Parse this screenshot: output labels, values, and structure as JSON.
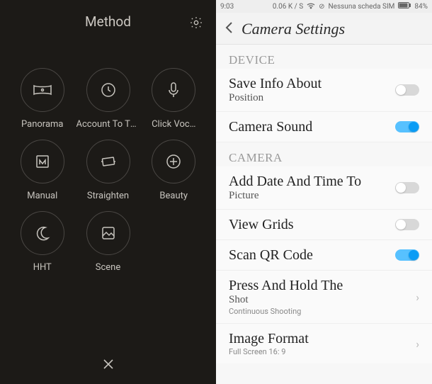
{
  "left": {
    "title": "Method",
    "tiles": [
      {
        "label": "Panorama",
        "icon": "panorama"
      },
      {
        "label": "Account To The…",
        "icon": "timer"
      },
      {
        "label": "Click Voc…",
        "icon": "mic"
      },
      {
        "label": "Manual",
        "icon": "manual"
      },
      {
        "label": "Straighten",
        "icon": "straighten"
      },
      {
        "label": "Beauty",
        "icon": "beauty"
      },
      {
        "label": "HHT",
        "icon": "moon"
      },
      {
        "label": "Scene",
        "icon": "scene"
      }
    ]
  },
  "right": {
    "status": {
      "time": "9:03",
      "speed": "0.06 K / S",
      "sim": "Nessuna scheda SIM",
      "battery": "84%"
    },
    "title": "Camera Settings",
    "sections": [
      {
        "label": "DEVICE",
        "items": [
          {
            "title": "Save Info About",
            "sub": "Position",
            "toggle": "off"
          },
          {
            "title": "Camera Sound",
            "toggle": "on"
          }
        ]
      },
      {
        "label": "CAMERA",
        "items": [
          {
            "title": "Add Date And Time To",
            "sub": "Picture",
            "toggle": "off"
          },
          {
            "title": "View Grids",
            "toggle": "off"
          },
          {
            "title": "Scan QR Code",
            "toggle": "on"
          },
          {
            "title": "Press And Hold The",
            "sub": "Shot",
            "desc": "Continuous Shooting",
            "chevron": true
          },
          {
            "title": "Image Format",
            "desc": "Full Screen 16: 9",
            "chevron": true
          }
        ]
      }
    ]
  }
}
